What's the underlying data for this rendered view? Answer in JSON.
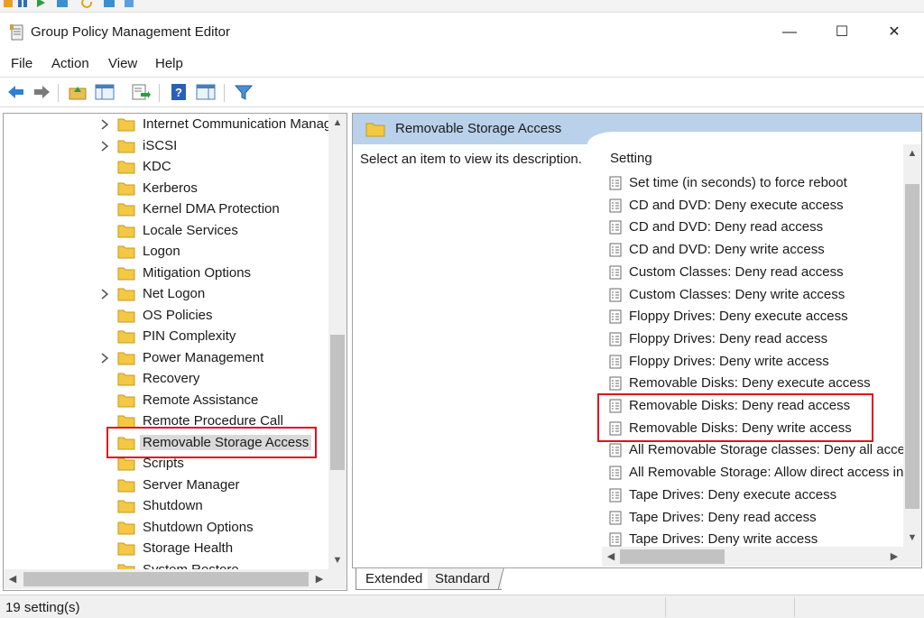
{
  "window": {
    "title": "Group Policy Management Editor",
    "minimize_glyph": "—",
    "maximize_glyph": "☐",
    "close_glyph": "✕"
  },
  "menu": [
    "File",
    "Action",
    "View",
    "Help"
  ],
  "toolbar": {
    "buttons": [
      "back-arrow-icon",
      "forward-arrow-icon",
      "up-folder-icon",
      "show-hide-tree-icon",
      "export-list-icon",
      "help-icon",
      "properties-pane-icon",
      "filter-icon"
    ]
  },
  "tree": {
    "items": [
      {
        "label": "Internet Communication Manag",
        "expandable": true
      },
      {
        "label": "iSCSI",
        "expandable": true
      },
      {
        "label": "KDC",
        "expandable": false
      },
      {
        "label": "Kerberos",
        "expandable": false
      },
      {
        "label": "Kernel DMA Protection",
        "expandable": false
      },
      {
        "label": "Locale Services",
        "expandable": false
      },
      {
        "label": "Logon",
        "expandable": false
      },
      {
        "label": "Mitigation Options",
        "expandable": false
      },
      {
        "label": "Net Logon",
        "expandable": true
      },
      {
        "label": "OS Policies",
        "expandable": false
      },
      {
        "label": "PIN Complexity",
        "expandable": false
      },
      {
        "label": "Power Management",
        "expandable": true
      },
      {
        "label": "Recovery",
        "expandable": false
      },
      {
        "label": "Remote Assistance",
        "expandable": false
      },
      {
        "label": "Remote Procedure Call",
        "expandable": false
      },
      {
        "label": "Removable Storage Access",
        "expandable": false,
        "selected": true
      },
      {
        "label": "Scripts",
        "expandable": false
      },
      {
        "label": "Server Manager",
        "expandable": false
      },
      {
        "label": "Shutdown",
        "expandable": false
      },
      {
        "label": "Shutdown Options",
        "expandable": false
      },
      {
        "label": "Storage Health",
        "expandable": false
      },
      {
        "label": "System Restore",
        "expandable": false
      }
    ]
  },
  "content": {
    "header_title": "Removable Storage Access",
    "description": "Select an item to view its description.",
    "column_header": "Setting",
    "settings": [
      "Set time (in seconds) to force reboot",
      "CD and DVD: Deny execute access",
      "CD and DVD: Deny read access",
      "CD and DVD: Deny write access",
      "Custom Classes: Deny read access",
      "Custom Classes: Deny write access",
      "Floppy Drives: Deny execute access",
      "Floppy Drives: Deny read access",
      "Floppy Drives: Deny write access",
      "Removable Disks: Deny execute access",
      "Removable Disks: Deny read access",
      "Removable Disks: Deny write access",
      "All Removable Storage classes: Deny all access",
      "All Removable Storage: Allow direct access in remote sessions",
      "Tape Drives: Deny execute access",
      "Tape Drives: Deny read access",
      "Tape Drives: Deny write access"
    ]
  },
  "tabs": [
    "Extended",
    "Standard"
  ],
  "status": {
    "text": "19 setting(s)"
  },
  "colors": {
    "header_band": "#b9d1ea",
    "highlight_red": "#e0101e",
    "folder_yellow": "#f4c842"
  }
}
